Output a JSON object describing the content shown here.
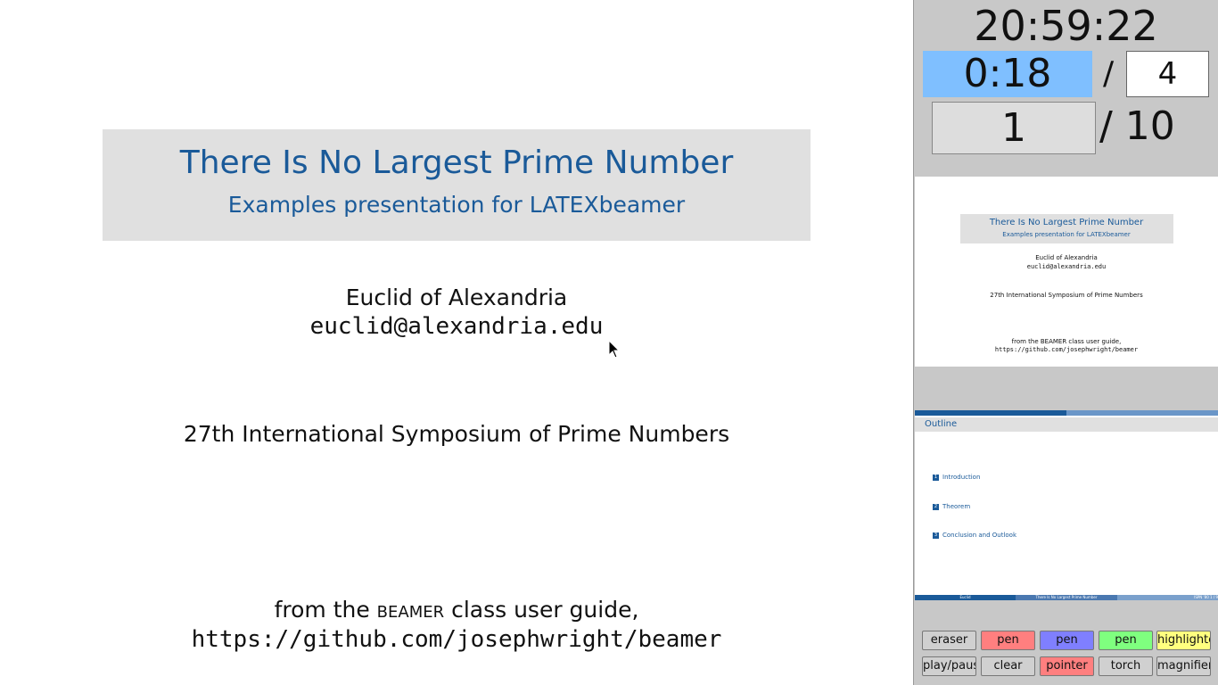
{
  "slide": {
    "title": "There Is No Largest Prime Number",
    "subtitle": "Examples presentation for LATEXbeamer",
    "author": "Euclid of Alexandria",
    "email": "euclid@alexandria.edu",
    "conference": "27th International Symposium of Prime Numbers",
    "source_prefix": "from the ",
    "source_sc": "beamer",
    "source_suffix": " class user guide,",
    "url": "https://github.com/josephwright/beamer"
  },
  "presenter": {
    "clock": "20:59:22",
    "elapsed": "0:18",
    "duration_sep": "/",
    "duration": "4",
    "current_slide": "1",
    "total_slides": "/ 10"
  },
  "thumb_current": {
    "title": "There Is No Largest Prime Number",
    "subtitle": "Examples presentation for LATEXbeamer",
    "author": "Euclid of Alexandria",
    "email": "euclid@alexandria.edu",
    "conference": "27th International Symposium of Prime Numbers",
    "source": "from the BEAMER class user guide,",
    "url": "https://github.com/josephwright/beamer"
  },
  "thumb_next": {
    "title": "Outline",
    "toc": [
      {
        "num": "1",
        "label": "Introduction"
      },
      {
        "num": "2",
        "label": "Theorem"
      },
      {
        "num": "3",
        "label": "Conclusion and Outlook"
      }
    ],
    "footer_left": "Euclid",
    "footer_mid": "There Is No Largest Prime Number",
    "footer_right": "ISPN '80     1 / 9"
  },
  "tools": [
    {
      "label": "eraser",
      "color": "#d0d0d0"
    },
    {
      "label": "pen",
      "color": "#ff7f7f"
    },
    {
      "label": "pen",
      "color": "#7f7fff"
    },
    {
      "label": "pen",
      "color": "#7fff7f"
    },
    {
      "label": "highlighter",
      "color": "#ffff7f"
    },
    {
      "label": "play/pause",
      "color": "#d0d0d0"
    },
    {
      "label": "clear",
      "color": "#d0d0d0"
    },
    {
      "label": "pointer",
      "color": "#ff7f7f"
    },
    {
      "label": "torch",
      "color": "#d0d0d0"
    },
    {
      "label": "magnifier",
      "color": "#d0d0d0"
    }
  ]
}
